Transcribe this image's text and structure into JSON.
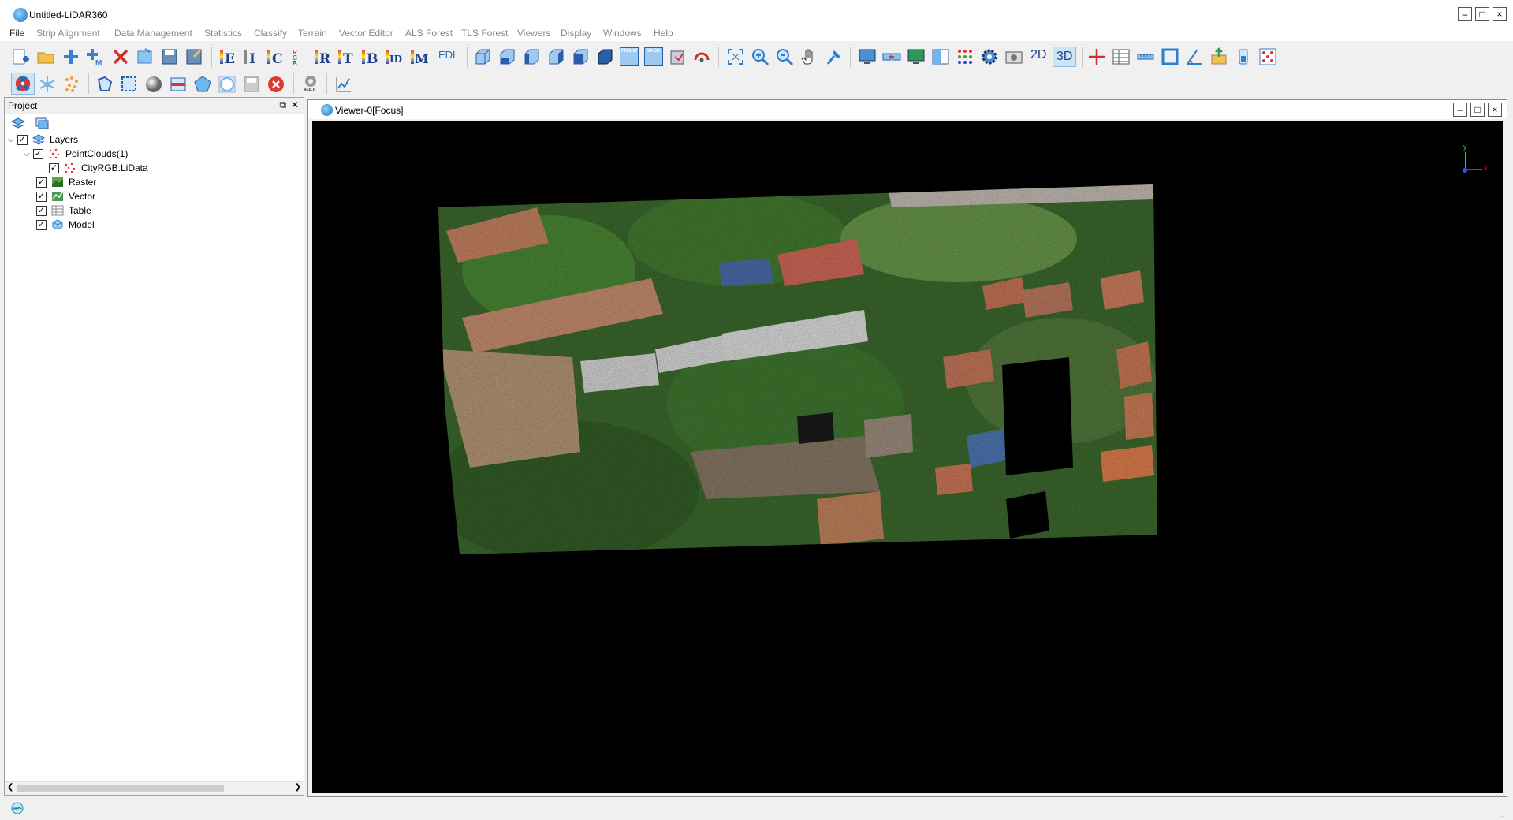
{
  "window": {
    "title": "Untitled-LiDAR360"
  },
  "menu": [
    "File",
    "Strip Alignment",
    "Data Management",
    "Statistics",
    "Classify",
    "Terrain",
    "Vector Editor",
    "ALS Forest",
    "TLS Forest",
    "Viewers",
    "Display",
    "Windows",
    "Help"
  ],
  "toolbar": {
    "edl_label": "EDL",
    "view_2d": "2D",
    "view_3d": "3D",
    "front_label": "FRONT",
    "back_label": "BACK",
    "bat_label": "BAT"
  },
  "project_panel": {
    "title": "Project",
    "tree": {
      "layers": "Layers",
      "pointclouds": "PointClouds(1)",
      "file": "CityRGB.LiData",
      "raster": "Raster",
      "vector": "Vector",
      "table": "Table",
      "model": "Model"
    }
  },
  "viewer": {
    "title": "Viewer-0[Focus]",
    "axis_y": "y",
    "axis_x": "x"
  },
  "colors": {
    "accent": "#1e6fb8",
    "viewer_bg": "#000000",
    "close_red": "#e03a2f"
  }
}
